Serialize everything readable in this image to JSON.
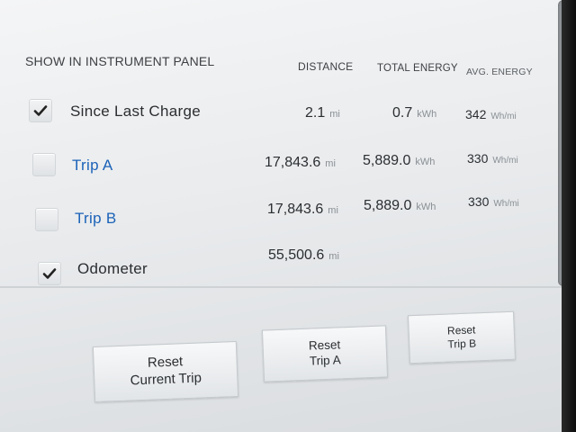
{
  "header": {
    "section_title": "SHOW IN INSTRUMENT PANEL",
    "col_distance": "DISTANCE",
    "col_total_energy": "TOTAL ENERGY",
    "col_avg_energy": "AVG. ENERGY"
  },
  "rows": [
    {
      "label": "Since Last Charge",
      "checked": true,
      "distance": "2.1",
      "distance_unit": "mi",
      "energy": "0.7",
      "energy_unit": "kWh",
      "avg": "342",
      "avg_unit": "Wh/mi"
    },
    {
      "label": "Trip A",
      "checked": false,
      "distance": "17,843.6",
      "distance_unit": "mi",
      "energy": "5,889.0",
      "energy_unit": "kWh",
      "avg": "330",
      "avg_unit": "Wh/mi"
    },
    {
      "label": "Trip B",
      "checked": false,
      "distance": "17,843.6",
      "distance_unit": "mi",
      "energy": "5,889.0",
      "energy_unit": "kWh",
      "avg": "330",
      "avg_unit": "Wh/mi"
    },
    {
      "label": "Odometer",
      "checked": true,
      "distance": "55,500.6",
      "distance_unit": "mi"
    }
  ],
  "buttons": {
    "reset_current_trip": "Reset\nCurrent Trip",
    "reset_trip_a": "Reset\nTrip A",
    "reset_trip_b": "Reset\nTrip B"
  },
  "colors": {
    "accent_blue": "#1b62b8",
    "text_dark": "#2b2e31",
    "unit_gray": "#8a8f94"
  },
  "icons": {
    "checkmark": "check-icon"
  }
}
